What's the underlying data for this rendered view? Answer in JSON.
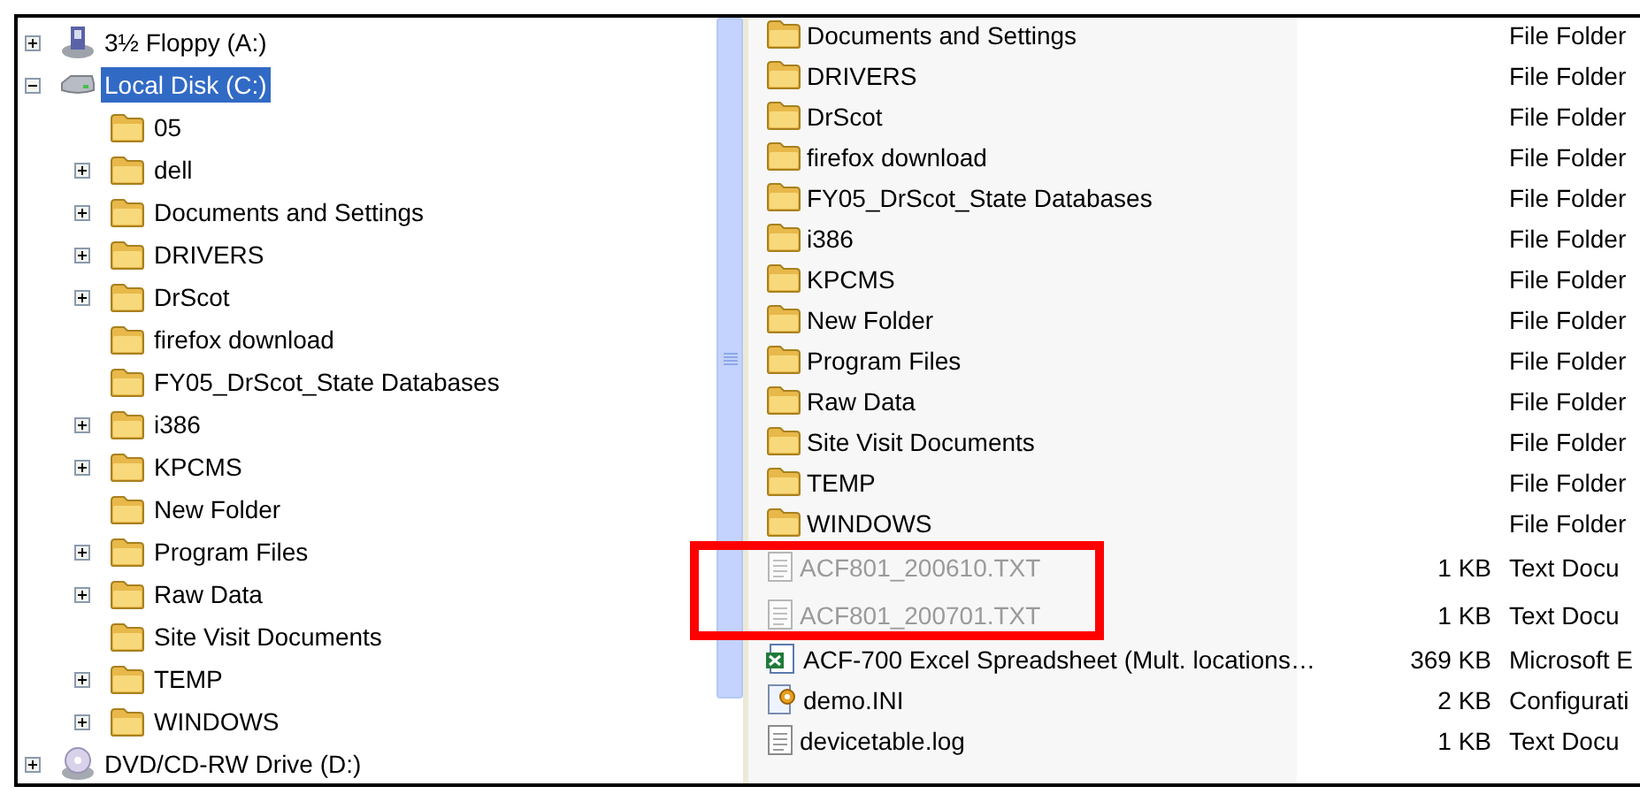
{
  "tree": [
    {
      "label": "3½ Floppy (A:)",
      "kind": "floppy",
      "expanded": false,
      "selected": false
    },
    {
      "label": "Local Disk (C:)",
      "kind": "disk",
      "expanded": true,
      "selected": true,
      "children": [
        {
          "label": "05",
          "kind": "folder",
          "selected": false
        },
        {
          "label": "dell",
          "kind": "folder",
          "expanded": false,
          "selected": false
        },
        {
          "label": "Documents and Settings",
          "kind": "folder",
          "expanded": false,
          "selected": false
        },
        {
          "label": "DRIVERS",
          "kind": "folder",
          "expanded": false,
          "selected": false
        },
        {
          "label": "DrScot",
          "kind": "folder",
          "expanded": false,
          "selected": false
        },
        {
          "label": "firefox download",
          "kind": "folder",
          "selected": false
        },
        {
          "label": "FY05_DrScot_State Databases",
          "kind": "folder",
          "selected": false
        },
        {
          "label": "i386",
          "kind": "folder",
          "expanded": false,
          "selected": false
        },
        {
          "label": "KPCMS",
          "kind": "folder",
          "expanded": false,
          "selected": false
        },
        {
          "label": "New Folder",
          "kind": "folder",
          "selected": false
        },
        {
          "label": "Program Files",
          "kind": "folder",
          "expanded": false,
          "selected": false
        },
        {
          "label": "Raw Data",
          "kind": "folder",
          "expanded": false,
          "selected": false
        },
        {
          "label": "Site Visit Documents",
          "kind": "folder",
          "selected": false
        },
        {
          "label": "TEMP",
          "kind": "folder",
          "expanded": false,
          "selected": false
        },
        {
          "label": "WINDOWS",
          "kind": "folder",
          "expanded": false,
          "selected": false
        }
      ]
    },
    {
      "label": "DVD/CD-RW Drive (D:)",
      "kind": "dvd",
      "expanded": false,
      "selected": false
    }
  ],
  "files": [
    {
      "name": "Documents and Settings",
      "kind": "folder",
      "type": "File Folder",
      "dimmed": false,
      "highlighted": false
    },
    {
      "name": "DRIVERS",
      "kind": "folder",
      "type": "File Folder",
      "dimmed": false,
      "highlighted": false
    },
    {
      "name": "DrScot",
      "kind": "folder",
      "type": "File Folder",
      "dimmed": false,
      "highlighted": false
    },
    {
      "name": "firefox download",
      "kind": "folder",
      "type": "File Folder",
      "dimmed": false,
      "highlighted": false
    },
    {
      "name": "FY05_DrScot_State Databases",
      "kind": "folder",
      "type": "File Folder",
      "dimmed": false,
      "highlighted": false
    },
    {
      "name": "i386",
      "kind": "folder",
      "type": "File Folder",
      "dimmed": false,
      "highlighted": false
    },
    {
      "name": "KPCMS",
      "kind": "folder",
      "type": "File Folder",
      "dimmed": false,
      "highlighted": false
    },
    {
      "name": "New Folder",
      "kind": "folder",
      "type": "File Folder",
      "dimmed": false,
      "highlighted": false
    },
    {
      "name": "Program Files",
      "kind": "folder",
      "type": "File Folder",
      "dimmed": false,
      "highlighted": false
    },
    {
      "name": "Raw Data",
      "kind": "folder",
      "type": "File Folder",
      "dimmed": false,
      "highlighted": false
    },
    {
      "name": "Site Visit Documents",
      "kind": "folder",
      "type": "File Folder",
      "dimmed": false,
      "highlighted": false
    },
    {
      "name": "TEMP",
      "kind": "folder",
      "type": "File Folder",
      "dimmed": false,
      "highlighted": false
    },
    {
      "name": "WINDOWS",
      "kind": "folder",
      "type": "File Folder",
      "dimmed": false,
      "highlighted": false
    },
    {
      "name": "ACF801_200610.TXT",
      "kind": "text",
      "size": "1 KB",
      "type": "Text Docu",
      "dimmed": true,
      "highlighted": true
    },
    {
      "name": "ACF801_200701.TXT",
      "kind": "text",
      "size": "1 KB",
      "type": "Text Docu",
      "dimmed": true,
      "highlighted": true
    },
    {
      "name": "ACF-700 Excel Spreadsheet (Mult. locations…",
      "kind": "excel",
      "size": "369 KB",
      "type": "Microsoft E",
      "dimmed": false,
      "highlighted": false
    },
    {
      "name": "demo.INI",
      "kind": "config",
      "size": "2 KB",
      "type": "Configurati",
      "dimmed": false,
      "highlighted": false
    },
    {
      "name": "devicetable.log",
      "kind": "text",
      "size": "1 KB",
      "type": "Text Docu",
      "dimmed": false,
      "highlighted": false
    }
  ]
}
